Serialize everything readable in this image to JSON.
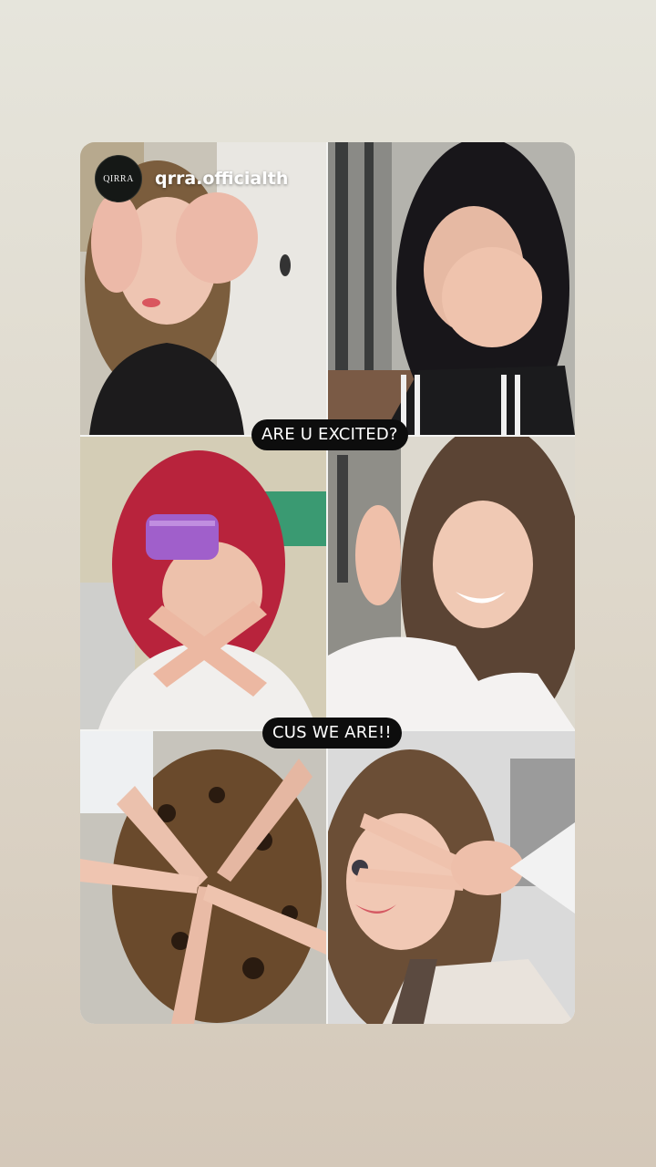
{
  "story": {
    "account": {
      "avatar_text": "QIRRA",
      "username": "qrra.officialth"
    },
    "stickers": [
      {
        "text": "ARE U EXCITED?"
      },
      {
        "text": "CUS WE ARE!!"
      }
    ],
    "colors": {
      "background_top": "#e6e5dc",
      "background_bottom": "#d4c8b9",
      "sticker_background": "#0d0d0d",
      "sticker_text": "#ffffff"
    }
  }
}
